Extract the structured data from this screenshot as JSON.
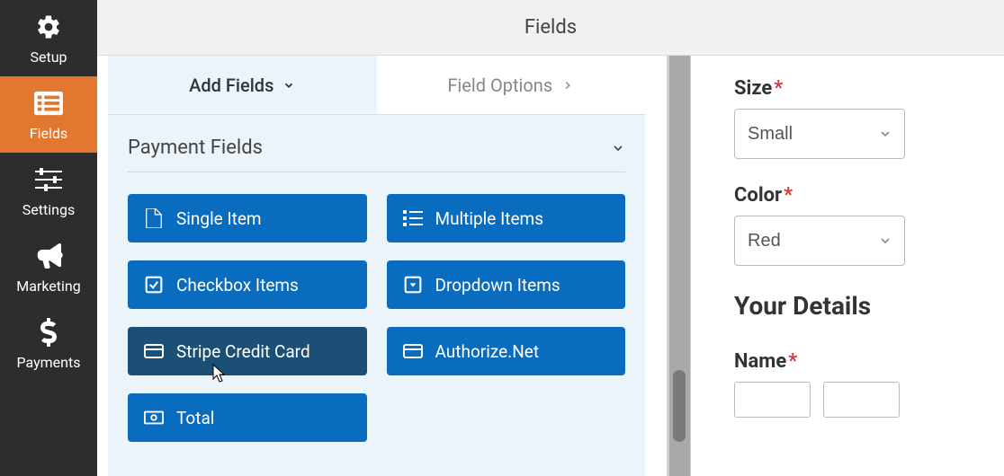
{
  "topbar_title": "Fields",
  "sidebar": [
    {
      "key": "setup",
      "label": "Setup",
      "icon": "gear"
    },
    {
      "key": "fields",
      "label": "Fields",
      "icon": "form",
      "active": true
    },
    {
      "key": "settings",
      "label": "Settings",
      "icon": "sliders"
    },
    {
      "key": "marketing",
      "label": "Marketing",
      "icon": "bullhorn"
    },
    {
      "key": "payments",
      "label": "Payments",
      "icon": "dollar"
    }
  ],
  "tabs": {
    "add_label": "Add Fields",
    "options_label": "Field Options"
  },
  "section_title": "Payment Fields",
  "fields": {
    "single": "Single Item",
    "multiple": "Multiple Items",
    "checkbox": "Checkbox Items",
    "dropdown": "Dropdown Items",
    "stripe": "Stripe Credit Card",
    "authorize": "Authorize.Net",
    "total": "Total"
  },
  "preview": {
    "size_label": "Size",
    "size_value": "Small",
    "color_label": "Color",
    "color_value": "Red",
    "details_heading": "Your Details",
    "name_label": "Name"
  }
}
